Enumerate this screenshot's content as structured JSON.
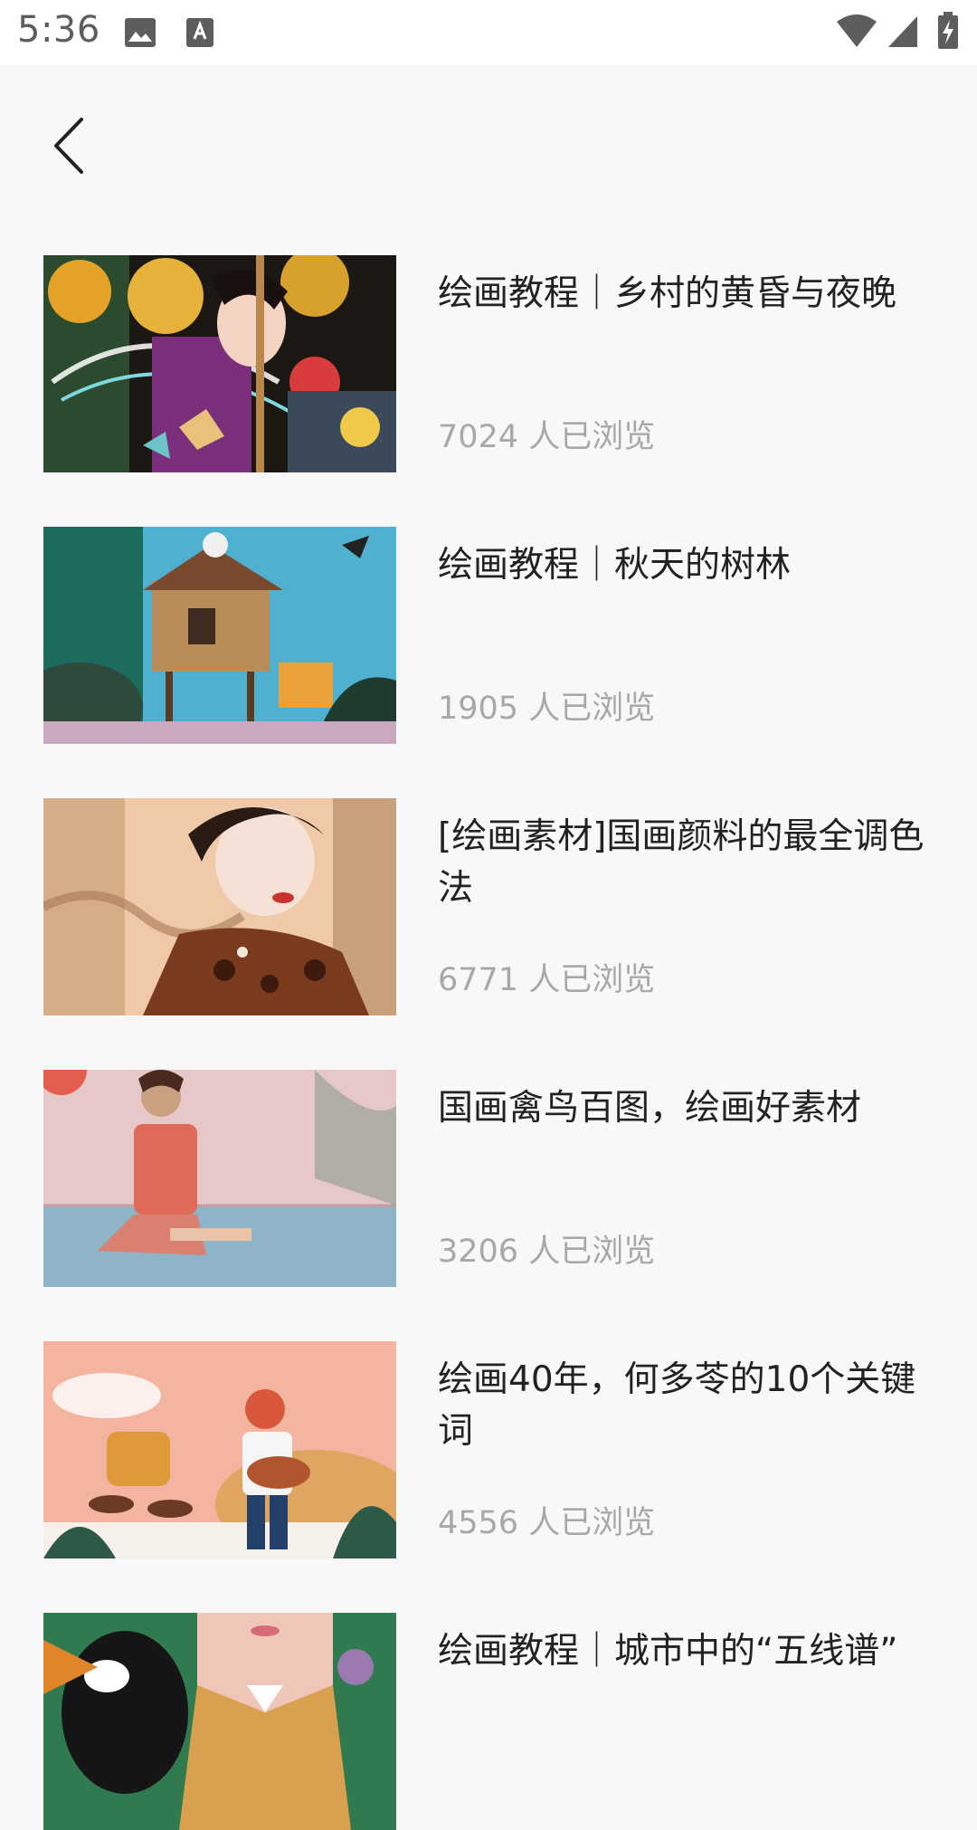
{
  "status_bar": {
    "time": "5:36",
    "icons": [
      "image-icon",
      "keyboard-a-icon",
      "wifi-icon",
      "signal-icon",
      "battery-charging-icon"
    ]
  },
  "nav": {
    "back_icon": "chevron-left-icon"
  },
  "articles": [
    {
      "title": "绘画教程｜乡村的黄昏与夜晚",
      "views": "7024 人已浏览",
      "thumbnail": "illustration-woman-with-butterflies"
    },
    {
      "title": "绘画教程｜秋天的树林",
      "views": "1905 人已浏览",
      "thumbnail": "illustration-treehouse-forest"
    },
    {
      "title": "[绘画素材]国画颜料的最全调色法",
      "views": "6771 人已浏览",
      "thumbnail": "illustration-woman-qipao"
    },
    {
      "title": "国画禽鸟百图，绘画好素材",
      "views": "3206 人已浏览",
      "thumbnail": "illustration-girl-by-pool"
    },
    {
      "title": "绘画40年，何多苓的10个关键词",
      "views": "4556 人已浏览",
      "thumbnail": "illustration-musicians"
    },
    {
      "title": "绘画教程｜城市中的“五线谱”",
      "views": "",
      "thumbnail": "illustration-bird-portrait"
    }
  ]
}
